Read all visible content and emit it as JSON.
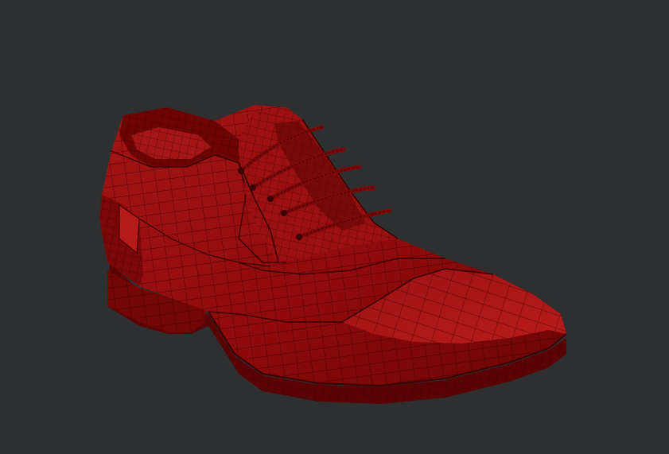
{
  "viewport": {
    "background": "#2e2f31"
  },
  "model": {
    "subject": "shoe-wireframe",
    "colors": {
      "base": "#8e0a0a",
      "highlight": "#b51a1a",
      "shadow": "#5c0404",
      "wire": "#2a0202",
      "lace": "#7a0808"
    },
    "lace_count": 5
  }
}
